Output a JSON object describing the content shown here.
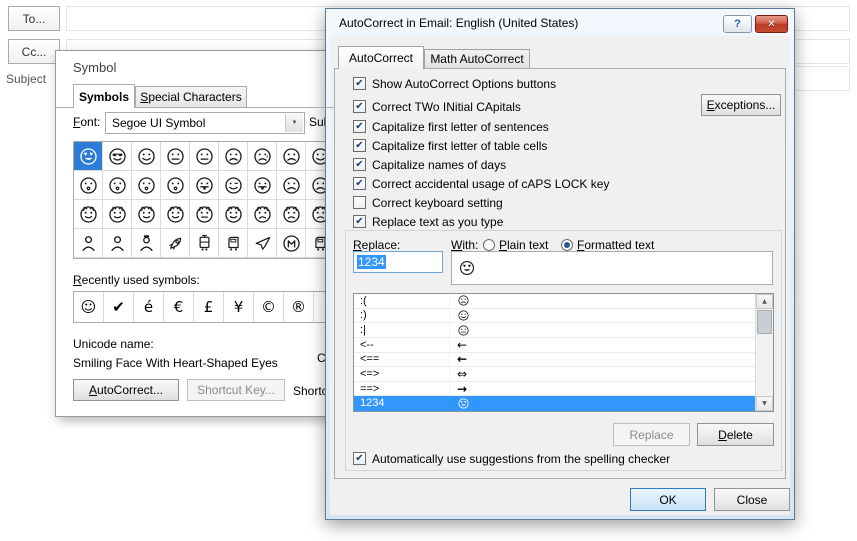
{
  "colors": {
    "selection_blue": "#3297FD",
    "close_button_red": "#C0392B"
  },
  "email": {
    "to_button": "To...",
    "cc_button": "Cc...",
    "subject_label": "Subject"
  },
  "symbol_dialog": {
    "title": "Symbol",
    "tabs": {
      "symbols": "Symbols",
      "special": {
        "pre": "",
        "key": "S",
        "post": "pecial Characters"
      }
    },
    "font_label": {
      "pre": "",
      "key": "F",
      "post": "ont:"
    },
    "font_value": "Segoe UI Symbol",
    "dropdown_arrow": "▼",
    "subset_label": "Subset:",
    "grid": {
      "selected": [
        0,
        0
      ],
      "rows": [
        [
          "face-heart-eyes",
          "face-sunglasses",
          "face-smile",
          "face-neutral",
          "face-neutral",
          "face-frown",
          "face-cry",
          "face-frown",
          "face-smile",
          "face-angry"
        ],
        [
          "face-kiss",
          "face-kiss",
          "face-kiss",
          "face-kiss",
          "face-tongue",
          "face-wink",
          "face-tongue",
          "face-frown",
          "face-frown",
          "face-cry"
        ],
        [
          "cat-smile",
          "cat-smile",
          "cat-smile",
          "cat-smile",
          "cat-neutral",
          "cat-smile",
          "cat-frown",
          "cat-frown",
          "cat-frown",
          "cat-neutral"
        ],
        [
          "person",
          "person",
          "guard",
          "rocket",
          "tram",
          "train",
          "plane",
          "metro",
          "train",
          "tram"
        ]
      ]
    },
    "recent_label": {
      "pre": "",
      "key": "R",
      "post": "ecently used symbols:"
    },
    "recent_symbols": [
      "☺",
      "✔",
      "é",
      "€",
      "£",
      "¥",
      "©",
      "®",
      ""
    ],
    "unicode_name_label": "Unicode name:",
    "unicode_name": "Smiling Face With Heart-Shaped Eyes",
    "char_code_label": "Character code:",
    "autocorrect_button": {
      "pre": "",
      "key": "A",
      "post": "utoCorrect..."
    },
    "shortcut_key_button": "Shortcut Key...",
    "shortcut_key_text": "Shortcut key:"
  },
  "autocorrect_dialog": {
    "title": "AutoCorrect in Email: English (United States)",
    "titlebar": {
      "help": "?",
      "close": "✕"
    },
    "tabs": {
      "autocorrect": "AutoCorrect",
      "math": "Math AutoCorrect"
    },
    "options": [
      {
        "label": "Show AutoCorrect Options buttons",
        "checked": true
      },
      {
        "label": "Correct TWo INitial CApitals",
        "checked": true
      },
      {
        "label": "Capitalize first letter of sentences",
        "checked": true
      },
      {
        "label": "Capitalize first letter of table cells",
        "checked": true
      },
      {
        "label": "Capitalize names of days",
        "checked": true
      },
      {
        "label": "Correct accidental usage of cAPS LOCK key",
        "checked": true
      },
      {
        "label": "Correct keyboard setting",
        "checked": false
      }
    ],
    "exceptions_button": {
      "pre": "",
      "key": "E",
      "post": "xceptions..."
    },
    "replace_text_checkbox": {
      "label": "Replace text as you type",
      "checked": true
    },
    "replace_label": {
      "pre": "",
      "key": "R",
      "post": "eplace:"
    },
    "with_label": {
      "pre": "",
      "key": "W",
      "post": "ith:"
    },
    "radio_plain": {
      "label": {
        "pre": "",
        "key": "P",
        "post": "lain text"
      },
      "selected": false
    },
    "radio_formatted": {
      "label": {
        "pre": "",
        "key": "F",
        "post": "ormatted text"
      },
      "selected": true
    },
    "replace_value": "1234",
    "with_icon": "face-heart-eyes",
    "replacements": [
      {
        "find": ":(",
        "icon": "face-frown"
      },
      {
        "find": ":)",
        "icon": "face-smile"
      },
      {
        "find": ":|",
        "icon": "face-neutral"
      },
      {
        "find": "<--",
        "text": "←",
        "bold": false
      },
      {
        "find": "<==",
        "text": "←",
        "bold": true
      },
      {
        "find": "<=>",
        "text": "⇔",
        "bold": false
      },
      {
        "find": "==>",
        "text": "→",
        "bold": true
      },
      {
        "find": "1234",
        "icon": "face-heart-eyes",
        "selected": true
      }
    ],
    "scrollbar": {
      "up": "▲",
      "down": "▼"
    },
    "replace_button": {
      "label": "Replace",
      "enabled": false
    },
    "delete_button": {
      "pre": "",
      "key": "D",
      "post": "elete"
    },
    "suggestions_checkbox": {
      "label": {
        "pre": "Automatically use su",
        "key": "g",
        "post": "gestions from the spelling checker"
      },
      "checked": true
    },
    "ok_button": "OK",
    "close_button": "Close"
  }
}
